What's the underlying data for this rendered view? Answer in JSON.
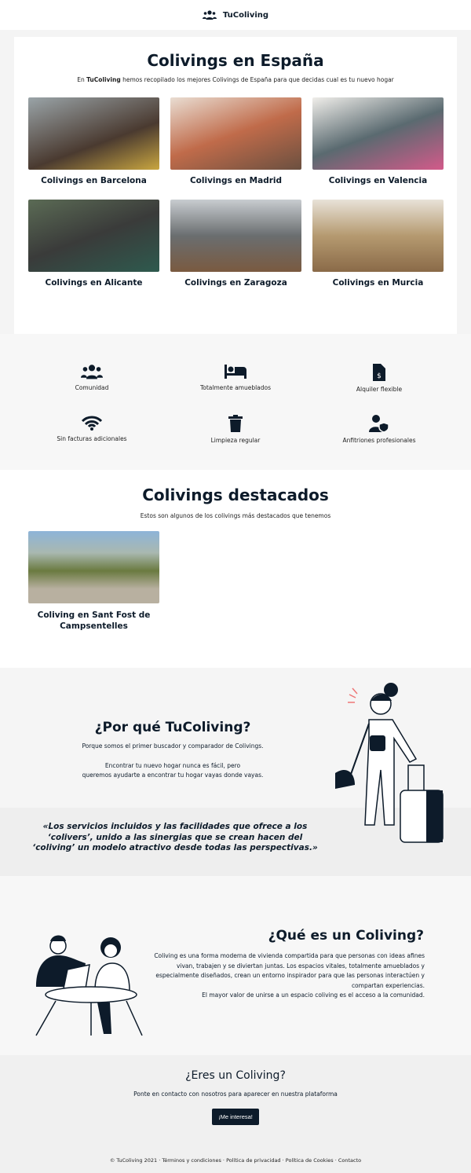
{
  "header": {
    "brand": "TuColiving",
    "icon": "users-icon"
  },
  "spain": {
    "title": "Colivings en España",
    "intro_prefix": "En",
    "intro_brand": "TuColiving",
    "intro_rest": "hemos recopilado los mejores Colivings de España para que decidas cual es tu nuevo hogar",
    "cities": [
      {
        "label": "Colivings en Barcelona"
      },
      {
        "label": "Colivings en Madrid"
      },
      {
        "label": "Colivings en Valencia"
      },
      {
        "label": "Colivings en Alicante"
      },
      {
        "label": "Colivings en Zaragoza"
      },
      {
        "label": "Colivings en Murcia"
      }
    ]
  },
  "features": [
    {
      "label": "Comunidad",
      "icon": "users-icon"
    },
    {
      "label": "Totalmente amueblados",
      "icon": "bed-icon"
    },
    {
      "label": "Alquiler flexible",
      "icon": "invoice-dollar-icon"
    },
    {
      "label": "Sin facturas adicionales",
      "icon": "wifi-icon"
    },
    {
      "label": "Limpieza regular",
      "icon": "trash-icon"
    },
    {
      "label": "Anfitriones profesionales",
      "icon": "user-shield-icon"
    }
  ],
  "featured": {
    "title": "Colivings destacados",
    "subtitle": "Estos son algunos de los colivings más destacados que tenemos",
    "items": [
      {
        "label": "Coliving en Sant Fost de Campsentelles"
      }
    ]
  },
  "why": {
    "title": "¿Por qué TuColiving?",
    "line1": "Porque somos el primer buscador y comparador de Colivings.",
    "line2": "Encontrar tu nuevo hogar nunca es fácil, pero",
    "line3": "queremos ayudarte a encontrar tu hogar vayas donde vayas.",
    "quote": "«Los servicios incluidos y las facilidades que ofrece  a los ‘colivers’, unido a las sinergias que se crean  hacen del ‘coliving’ un modelo atractivo desde todas las perspectivas.»"
  },
  "what": {
    "title": "¿Qué es un Coliving?",
    "p1": "Coliving es una forma moderna de vivienda compartida para que personas con ideas afines vivan, trabajen y se diviertan juntas. Los espacios vitales, totalmente amueblados y especialmente diseñados, crean un entorno inspirador para que las personas interactúen y compartan experiencias.",
    "p2": "El mayor valor de unirse a un espacio coliving es el acceso a la comunidad."
  },
  "cta": {
    "title": "¿Eres un Coliving?",
    "text": "Ponte en contacto con nosotros para aparecer en nuestra plataforma",
    "button": "¡Me interesa!"
  },
  "footer": {
    "copyright": "© TuColiving 2021",
    "links": [
      "Términos y condiciones",
      "Política de privacidad",
      "Política de Cookies",
      "Contacto"
    ]
  },
  "colors": {
    "primary": "#0d1b2a"
  }
}
